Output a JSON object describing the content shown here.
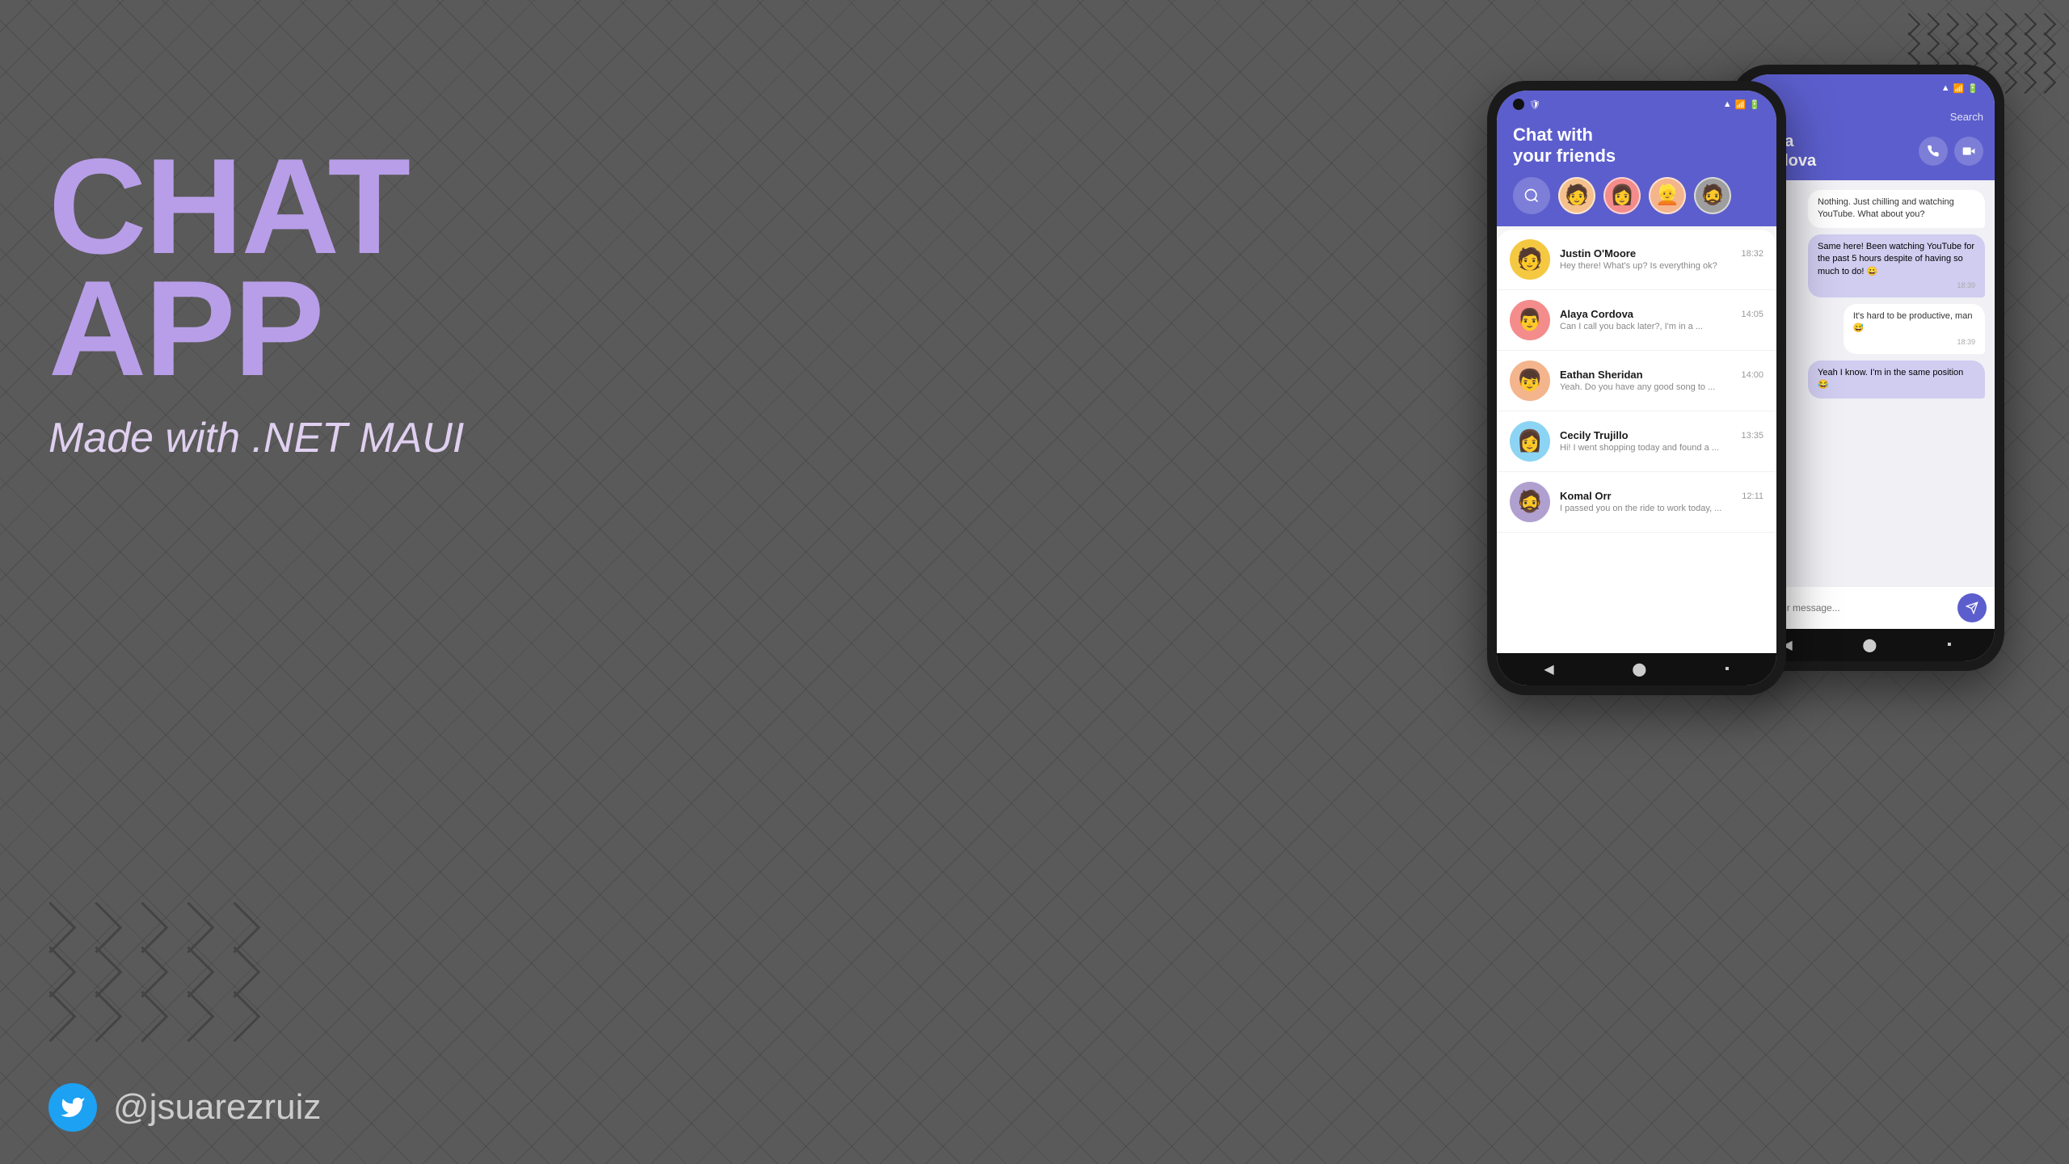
{
  "background": {
    "color": "#5c5c5c"
  },
  "app_title": {
    "line1": "CHAT",
    "line2": "APP"
  },
  "subtitle": "Made with .NET MAUI",
  "twitter": {
    "handle": "@jsuarezruiz"
  },
  "phone1": {
    "header": {
      "title_line1": "Chat with",
      "title_line2": "your friends"
    },
    "contacts": [
      {
        "name": "Justin O'Moore",
        "time": "18:32",
        "preview": "Hey there! What's up? Is everything ok?",
        "avatar_emoji": "🧑",
        "avatar_bg": "#f5c842"
      },
      {
        "name": "Alaya Cordova",
        "time": "14:05",
        "preview": "Can I call you back later?, I'm in a ...",
        "avatar_emoji": "👨",
        "avatar_bg": "#f48c8c"
      },
      {
        "name": "Eathan Sheridan",
        "time": "14:00",
        "preview": "Yeah. Do you have any good song to ...",
        "avatar_emoji": "👦",
        "avatar_bg": "#f4b48c"
      },
      {
        "name": "Cecily Trujillo",
        "time": "13:35",
        "preview": "Hi! I went shopping today and found a ...",
        "avatar_emoji": "👩",
        "avatar_bg": "#8cd4f4"
      },
      {
        "name": "Komal Orr",
        "time": "12:11",
        "preview": "I passed you on the ride to work today, ...",
        "avatar_emoji": "🧔",
        "avatar_bg": "#9e9e9e"
      }
    ],
    "story_avatars": [
      "🧑",
      "👩",
      "👱",
      "🧔"
    ]
  },
  "phone2": {
    "contact_name_line1": "Alaya",
    "contact_name_line2": "Cordova",
    "search_label": "Search",
    "messages": [
      {
        "text": "Nothing. Just chilling and watching YouTube. What about you?",
        "type": "received",
        "time": ""
      },
      {
        "text": "Same here! Been watching YouTube for the past 5 hours despite of having so much to do! 😀",
        "type": "sent_light",
        "time": "18:39"
      },
      {
        "text": "It's hard to be productive, man 😅",
        "type": "received_small",
        "time": "18:39"
      },
      {
        "text": "Yeah I know. I'm in the same position 😂",
        "type": "sent_light2",
        "time": ""
      }
    ],
    "input_placeholder": "Type your message..."
  }
}
